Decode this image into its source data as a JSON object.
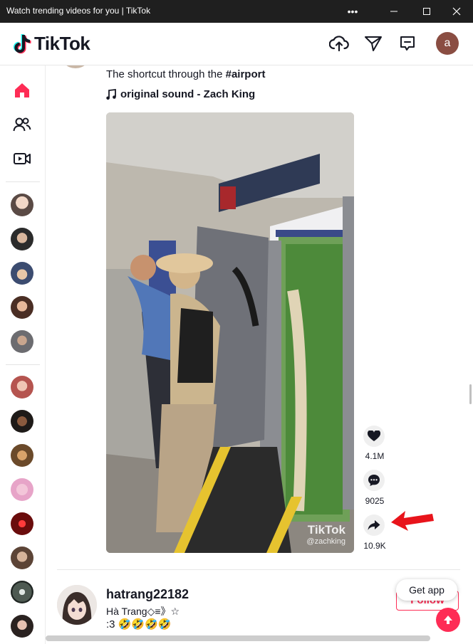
{
  "window": {
    "title": "Watch trending videos for you | TikTok"
  },
  "header": {
    "logo_text": "TikTok",
    "avatar_letter": "a"
  },
  "post": {
    "caption_text": "The shortcut through the ",
    "caption_tag": "#airport",
    "sound": "original sound - Zach King",
    "watermark_brand": "TikTok",
    "watermark_user": "@zachking",
    "likes": "4.1M",
    "comments": "9025",
    "shares": "10.9K"
  },
  "next_post": {
    "username": "hatrang22182",
    "nickname": "Hà Trang◇≡》☆",
    "caption": ":3 🤣🤣🤣🤣",
    "follow_label": "Follow"
  },
  "overlay": {
    "get_app_label": "Get app"
  },
  "colors": {
    "brand": "#fe2c55",
    "annotation_arrow": "#e8141b"
  },
  "icons": {
    "sidebar": [
      "home-icon",
      "following-icon",
      "live-icon"
    ],
    "header": [
      "upload-icon",
      "messages-icon",
      "inbox-icon"
    ],
    "actions": [
      "heart-icon",
      "comment-icon",
      "share-icon"
    ]
  }
}
